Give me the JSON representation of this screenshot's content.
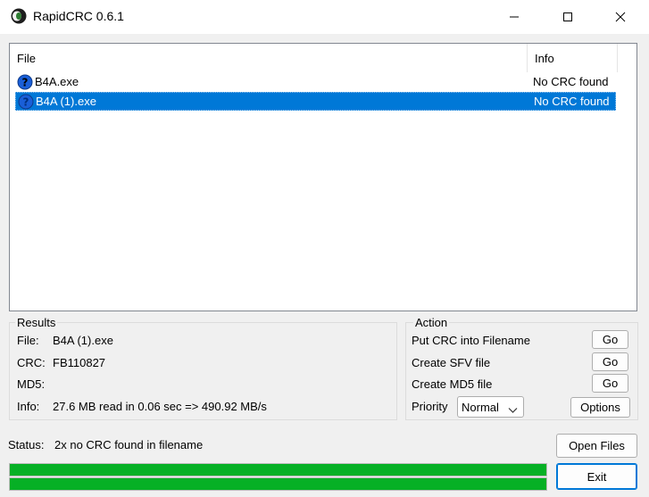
{
  "window": {
    "title": "RapidCRC 0.6.1"
  },
  "file_list": {
    "columns": [
      "File",
      "Info"
    ],
    "rows": [
      {
        "name": "B4A.exe",
        "info": "No CRC found",
        "icon": "question-icon",
        "selected": false
      },
      {
        "name": "B4A (1).exe",
        "info": "No CRC found",
        "icon": "question-icon",
        "selected": true
      }
    ]
  },
  "results": {
    "title": "Results",
    "file_label": "File:",
    "file_value": "B4A (1).exe",
    "crc_label": "CRC:",
    "crc_value": "FB110827",
    "md5_label": "MD5:",
    "md5_value": "",
    "info_label": "Info:",
    "info_value": "27.6 MB read in 0.06 sec => 490.92 MB/s"
  },
  "action": {
    "title": "Action",
    "items": [
      {
        "label": "Put CRC into Filename",
        "button": "Go"
      },
      {
        "label": "Create SFV file",
        "button": "Go"
      },
      {
        "label": "Create MD5 file",
        "button": "Go"
      }
    ],
    "priority_label": "Priority",
    "priority_value": "Normal",
    "options_button": "Options"
  },
  "status": {
    "label": "Status:",
    "text": "2x no CRC found in filename"
  },
  "buttons": {
    "open_files": "Open Files",
    "exit": "Exit"
  },
  "progress": {
    "bar1_fraction": 1.0,
    "bar2_fraction": 1.0
  },
  "colors": {
    "selection": "#0078d7",
    "progress": "#06b025",
    "icon_blue": "#1a5fd8"
  }
}
